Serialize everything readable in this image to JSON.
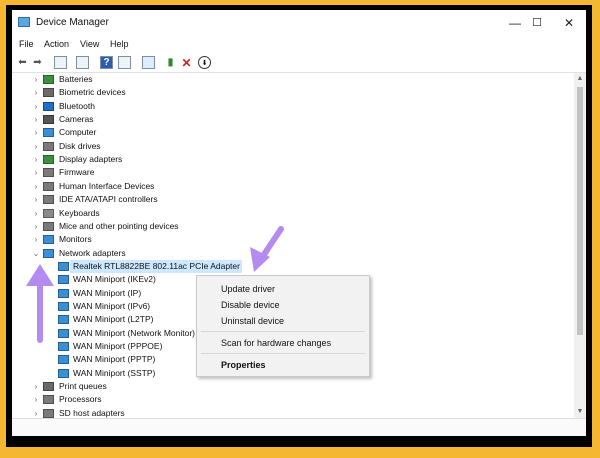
{
  "window": {
    "title": "Device Manager",
    "controls": {
      "minimize": "—",
      "maximize": "☐",
      "close": "✕"
    }
  },
  "menu": [
    "File",
    "Action",
    "View",
    "Help"
  ],
  "toolbar_icons": [
    "back-icon",
    "forward-icon",
    "properties-icon",
    "list-icon",
    "help-icon",
    "computer-view-icon",
    "monitor-icon",
    "add-driver-icon",
    "remove-device-icon",
    "download-driver-icon"
  ],
  "tree": {
    "categories": [
      {
        "label": "Batteries",
        "icon": "battery-icon",
        "color": "#3c8f3c"
      },
      {
        "label": "Biometric devices",
        "icon": "fingerprint-icon",
        "color": "#6a6a6a"
      },
      {
        "label": "Bluetooth",
        "icon": "bluetooth-icon",
        "color": "#1e6fc8"
      },
      {
        "label": "Cameras",
        "icon": "camera-icon",
        "color": "#555555"
      },
      {
        "label": "Computer",
        "icon": "computer-icon",
        "color": "#3a8fd6"
      },
      {
        "label": "Disk drives",
        "icon": "disk-icon",
        "color": "#7a7a7a"
      },
      {
        "label": "Display adapters",
        "icon": "display-adapter-icon",
        "color": "#3c8f3c"
      },
      {
        "label": "Firmware",
        "icon": "firmware-icon",
        "color": "#7a7a7a"
      },
      {
        "label": "Human Interface Devices",
        "icon": "hid-icon",
        "color": "#7a7a7a"
      },
      {
        "label": "IDE ATA/ATAPI controllers",
        "icon": "ide-icon",
        "color": "#7a7a7a"
      },
      {
        "label": "Keyboards",
        "icon": "keyboard-icon",
        "color": "#8a8a8a"
      },
      {
        "label": "Mice and other pointing devices",
        "icon": "mouse-icon",
        "color": "#7a7a7a"
      },
      {
        "label": "Monitors",
        "icon": "monitor-icon",
        "color": "#3a8fd6"
      },
      {
        "label": "Network adapters",
        "icon": "network-adapter-icon",
        "color": "#3a8fd6"
      }
    ],
    "network_children": [
      "Realtek RTL8822BE 802.11ac PCIe Adapter",
      "WAN Miniport (IKEv2)",
      "WAN Miniport (IP)",
      "WAN Miniport (IPv6)",
      "WAN Miniport (L2TP)",
      "WAN Miniport (Network Monitor)",
      "WAN Miniport (PPPOE)",
      "WAN Miniport (PPTP)",
      "WAN Miniport (SSTP)"
    ],
    "after_categories": [
      {
        "label": "Print queues",
        "icon": "printer-icon",
        "color": "#6a6a6a"
      },
      {
        "label": "Processors",
        "icon": "processor-icon",
        "color": "#7a7a7a"
      },
      {
        "label": "SD host adapters",
        "icon": "sd-icon",
        "color": "#7a7a7a"
      }
    ]
  },
  "context_menu": {
    "items": [
      "Update driver",
      "Disable device",
      "Uninstall device",
      "Scan for hardware changes",
      "Properties"
    ]
  },
  "colors": {
    "background": "#f5b731",
    "selection": "#cce8ff",
    "annotation_arrow": "#b48cf0"
  }
}
